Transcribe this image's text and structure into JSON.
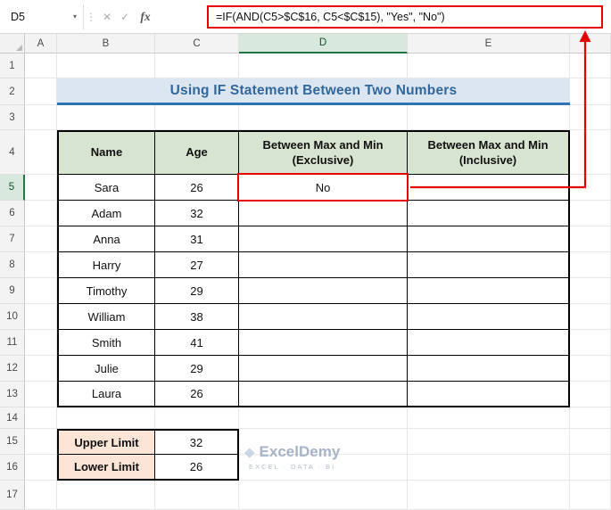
{
  "formula_bar": {
    "name_box_value": "D5",
    "dropdown_icon": "▾",
    "separator_icon": "⋮",
    "cancel_icon": "✕",
    "enter_icon": "✓",
    "fx_icon": "fx",
    "formula": "=IF(AND(C5>$C$16, C5<$C$15), \"Yes\", \"No\")"
  },
  "sheet": {
    "column_headers": [
      "A",
      "B",
      "C",
      "D",
      "E"
    ],
    "active_column": "D",
    "active_row": 5,
    "row_count": 17,
    "title": "Using IF Statement Between Two Numbers",
    "table": {
      "headers": [
        "Name",
        "Age",
        "Between Max and Min (Exclusive)",
        "Between Max and Min (Inclusive)"
      ],
      "rows": [
        {
          "name": "Sara",
          "age": 26,
          "exclusive": "No",
          "inclusive": ""
        },
        {
          "name": "Adam",
          "age": 32,
          "exclusive": "",
          "inclusive": ""
        },
        {
          "name": "Anna",
          "age": 31,
          "exclusive": "",
          "inclusive": ""
        },
        {
          "name": "Harry",
          "age": 27,
          "exclusive": "",
          "inclusive": ""
        },
        {
          "name": "Timothy",
          "age": 29,
          "exclusive": "",
          "inclusive": ""
        },
        {
          "name": "William",
          "age": 38,
          "exclusive": "",
          "inclusive": ""
        },
        {
          "name": "Smith",
          "age": 41,
          "exclusive": "",
          "inclusive": ""
        },
        {
          "name": "Julie",
          "age": 29,
          "exclusive": "",
          "inclusive": ""
        },
        {
          "name": "Laura",
          "age": 26,
          "exclusive": "",
          "inclusive": ""
        }
      ]
    },
    "limits": [
      {
        "label": "Upper Limit",
        "value": 32
      },
      {
        "label": "Lower Limit",
        "value": 26
      }
    ],
    "active_cell": {
      "ref": "D5",
      "value": "No"
    }
  },
  "watermark": {
    "logo_icon": "◆",
    "brand": "ExcelDemy",
    "tagline": "EXCEL · DATA · BI"
  },
  "colors": {
    "accent_green": "#217346",
    "table_header_bg": "#D7E4CF",
    "title_bg": "#DCE6F0",
    "title_text": "#31679B",
    "limit_bg": "#FCE4D6",
    "annotation_red": "#E60000"
  }
}
